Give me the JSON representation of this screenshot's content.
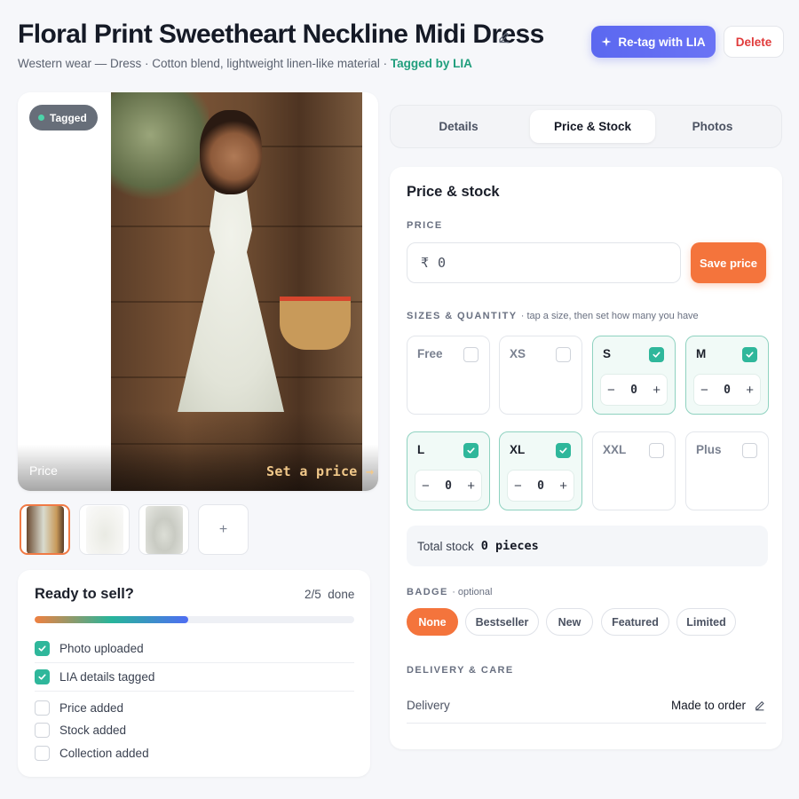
{
  "header": {
    "title": "Floral Print Sweetheart Neckline Midi Dress",
    "subtitle_prefix": "Western wear — Dress · Cotton blend, lightweight linen-like material · ",
    "tagged_label": "Tagged by LIA",
    "retag_label": "Re-tag with LIA",
    "delete_label": "Delete"
  },
  "image": {
    "badge": "Tagged",
    "price_label": "Price",
    "set_price_label": "Set a price →"
  },
  "thumbs": {
    "add_label": "+"
  },
  "ready": {
    "title": "Ready to sell?",
    "count": "2/5",
    "count_suffix": "done",
    "progress": 0.48,
    "items": [
      {
        "label": "Photo uploaded",
        "done": true
      },
      {
        "label": "LIA details tagged",
        "done": true
      },
      {
        "label": "Price added",
        "done": false
      },
      {
        "label": "Stock added",
        "done": false
      },
      {
        "label": "Collection added",
        "done": false
      }
    ]
  },
  "tabs": [
    {
      "label": "Details",
      "active": false
    },
    {
      "label": "Price & Stock",
      "active": true
    },
    {
      "label": "Photos",
      "active": false
    }
  ],
  "panel": {
    "title": "Price & stock",
    "price_section": "PRICE",
    "currency": "₹",
    "price_value": "0",
    "save_price_label": "Save price",
    "sizes_section": "SIZES & QUANTITY",
    "sizes_hint": "· tap a size, then set how many you have",
    "sizes": [
      {
        "name": "Free",
        "checked": false,
        "qty": null
      },
      {
        "name": "XS",
        "checked": false,
        "qty": null
      },
      {
        "name": "S",
        "checked": true,
        "qty": "0"
      },
      {
        "name": "M",
        "checked": true,
        "qty": "0"
      },
      {
        "name": "L",
        "checked": true,
        "qty": "0"
      },
      {
        "name": "XL",
        "checked": true,
        "qty": "0"
      },
      {
        "name": "XXL",
        "checked": false,
        "qty": null
      },
      {
        "name": "Plus",
        "checked": false,
        "qty": null
      }
    ],
    "total_label": "Total stock",
    "total_value": "0 pieces",
    "badge_section": "BADGE",
    "badge_hint": "· optional",
    "badges": [
      {
        "label": "None",
        "selected": true
      },
      {
        "label": "Bestseller",
        "selected": false
      },
      {
        "label": "New",
        "selected": false
      },
      {
        "label": "Featured",
        "selected": false
      },
      {
        "label": "Limited",
        "selected": false
      }
    ],
    "delivery_section": "DELIVERY & CARE",
    "delivery_key": "Delivery",
    "delivery_value": "Made to order"
  },
  "colors": {
    "accent_orange": "#f4743c",
    "accent_indigo": "#5b68f0",
    "check_green": "#2fb79b",
    "tagged_green": "#1f9e7c",
    "delete_red": "#e03a3a"
  }
}
